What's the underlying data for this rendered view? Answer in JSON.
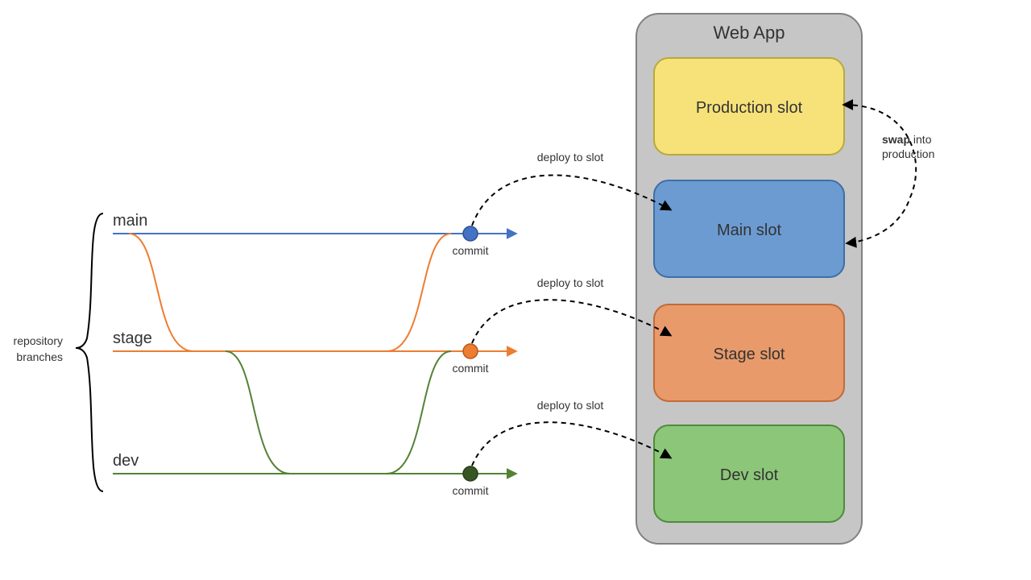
{
  "webapp": {
    "title": "Web App",
    "slots": [
      {
        "label": "Production slot"
      },
      {
        "label": "Main slot"
      },
      {
        "label": "Stage slot"
      },
      {
        "label": "Dev slot"
      }
    ]
  },
  "branches_title_line1": "repository",
  "branches_title_line2": "branches",
  "branches": [
    {
      "label": "main",
      "commit": "commit",
      "deploy": "deploy to slot"
    },
    {
      "label": "stage",
      "commit": "commit",
      "deploy": "deploy to slot"
    },
    {
      "label": "dev",
      "commit": "commit",
      "deploy": "deploy to slot"
    }
  ],
  "swap_label_bold": "swap",
  "swap_label_rest": " into",
  "swap_label_line2": "production",
  "colors": {
    "webapp_fill": "#C6C6C6",
    "webapp_stroke": "#818181",
    "prod_fill": "#F7E27A",
    "prod_stroke": "#B8A93C",
    "main_fill": "#6C9BD1",
    "main_stroke": "#3C6FA8",
    "stage_fill": "#E99A6B",
    "stage_stroke": "#C26A38",
    "dev_fill": "#8CC779",
    "dev_stroke": "#4F8B3B",
    "branch_main": "#4472C4",
    "branch_stage": "#ED7D31",
    "branch_dev": "#548235"
  }
}
